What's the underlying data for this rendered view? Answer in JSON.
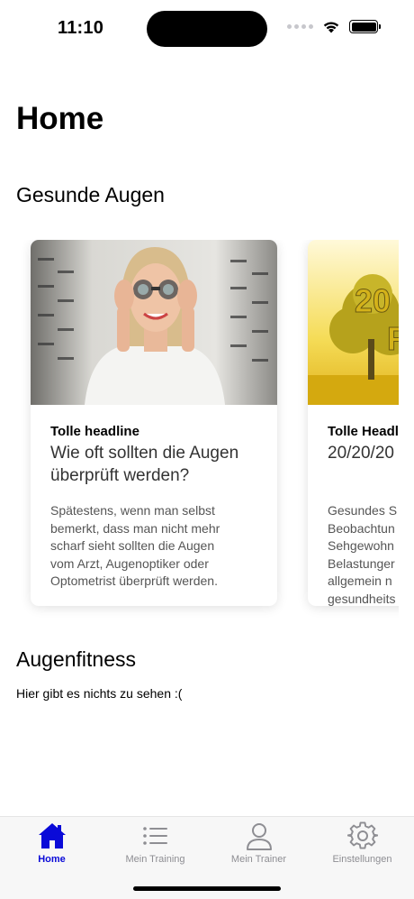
{
  "status_bar": {
    "time": "11:10"
  },
  "page": {
    "title": "Home"
  },
  "sections": {
    "gesunde_augen": {
      "title": "Gesunde Augen",
      "cards": [
        {
          "headline": "Tolle headline",
          "subtitle_lines": [
            "Wie oft sollten die Augen",
            "überprüft werden?"
          ],
          "text_lines": [
            "Spätestens, wenn man selbst",
            "bemerkt, dass man nicht mehr",
            "scharf sieht sollten die Augen",
            "vom Arzt, Augenoptiker oder",
            "Optometrist überprüft werden."
          ]
        },
        {
          "headline": "Tolle Headl",
          "subtitle_lines": [
            "20/20/20"
          ],
          "image_text": [
            "20",
            "R"
          ],
          "text_lines": [
            "Gesundes S",
            "Beobachtun",
            "Sehgewohn",
            "Belastunger",
            "allgemein n",
            "gesundheits"
          ]
        }
      ]
    },
    "augenfitness": {
      "title": "Augenfitness",
      "empty_text": "Hier gibt es nichts zu sehen :("
    }
  },
  "tab_bar": {
    "accent_color": "#0a0ad8",
    "inactive_color": "#8e8e93",
    "tabs": [
      {
        "label": "Home",
        "icon": "house-icon",
        "active": true
      },
      {
        "label": "Mein Training",
        "icon": "list-icon",
        "active": false
      },
      {
        "label": "Mein Trainer",
        "icon": "person-icon",
        "active": false
      },
      {
        "label": "Einstellungen",
        "icon": "gear-icon",
        "active": false
      }
    ]
  }
}
